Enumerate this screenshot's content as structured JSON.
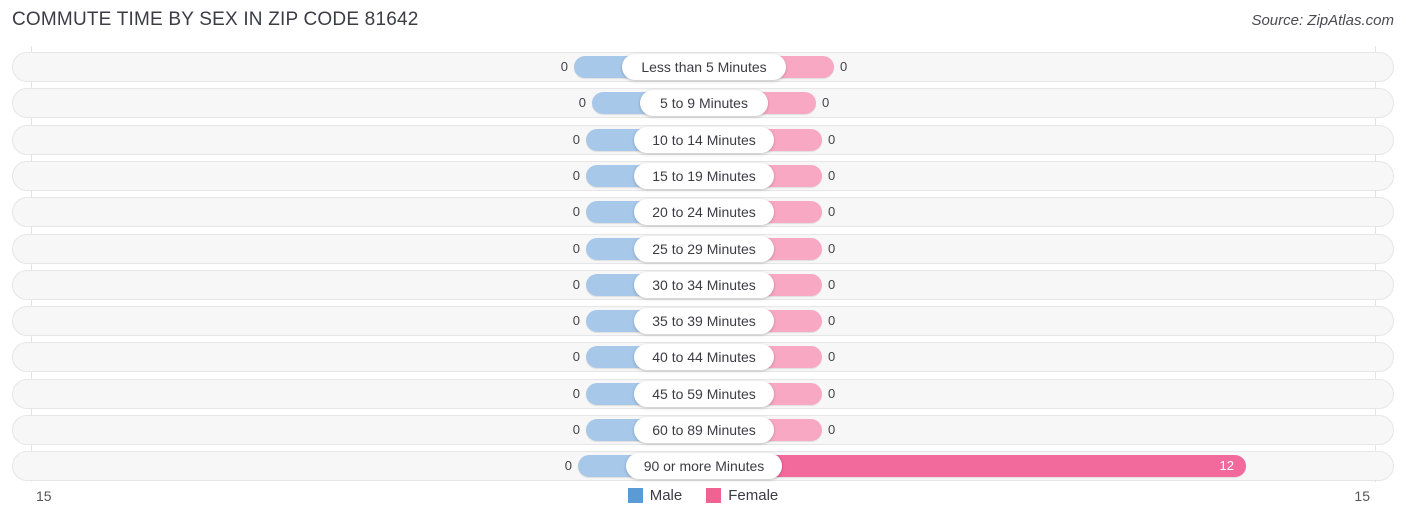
{
  "header": {
    "title": "COMMUTE TIME BY SEX IN ZIP CODE 81642",
    "source": "Source: ZipAtlas.com"
  },
  "legend": {
    "male": {
      "label": "Male",
      "color": "#5b9bd5"
    },
    "female": {
      "label": "Female",
      "color": "#f06292"
    }
  },
  "axis": {
    "left_label": "15",
    "right_label": "15"
  },
  "colors": {
    "male_bar": "#a8c8ea",
    "female_bar": "#f9a8c4",
    "female_bar_strong": "#f2699c",
    "row_background": "#f7f7f7",
    "row_border": "#e6e6e8",
    "gridline": "#e3e3e6"
  },
  "chart_data": {
    "type": "bar",
    "title": "COMMUTE TIME BY SEX IN ZIP CODE 81642",
    "subtitle": "Source: ZipAtlas.com",
    "orientation": "horizontal",
    "style": "diverging-bidirectional",
    "xlabel": "",
    "ylabel": "",
    "xlim": [
      15,
      15
    ],
    "grid": true,
    "legend_position": "bottom-center",
    "categories": [
      "Less than 5 Minutes",
      "5 to 9 Minutes",
      "10 to 14 Minutes",
      "15 to 19 Minutes",
      "20 to 24 Minutes",
      "25 to 29 Minutes",
      "30 to 34 Minutes",
      "35 to 39 Minutes",
      "40 to 44 Minutes",
      "45 to 59 Minutes",
      "60 to 89 Minutes",
      "90 or more Minutes"
    ],
    "series": [
      {
        "name": "Male",
        "direction": "left",
        "max": 15,
        "values": [
          0,
          0,
          0,
          0,
          0,
          0,
          0,
          0,
          0,
          0,
          0,
          0
        ],
        "value_labels": [
          "0",
          "0",
          "0",
          "0",
          "0",
          "0",
          "0",
          "0",
          "0",
          "0",
          "0",
          "0"
        ]
      },
      {
        "name": "Female",
        "direction": "right",
        "max": 15,
        "values": [
          0,
          0,
          0,
          0,
          0,
          0,
          0,
          0,
          0,
          0,
          0,
          12
        ],
        "value_labels": [
          "0",
          "0",
          "0",
          "0",
          "0",
          "0",
          "0",
          "0",
          "0",
          "0",
          "0",
          "12"
        ]
      }
    ],
    "rows": [
      {
        "label": "Less than 5 Minutes",
        "male": 0,
        "female": 0,
        "male_label": "0",
        "female_label": "0",
        "label_width": 164
      },
      {
        "label": "5 to 9 Minutes",
        "male": 0,
        "female": 0,
        "male_label": "0",
        "female_label": "0",
        "label_width": 128
      },
      {
        "label": "10 to 14 Minutes",
        "male": 0,
        "female": 0,
        "male_label": "0",
        "female_label": "0",
        "label_width": 140
      },
      {
        "label": "15 to 19 Minutes",
        "male": 0,
        "female": 0,
        "male_label": "0",
        "female_label": "0",
        "label_width": 140
      },
      {
        "label": "20 to 24 Minutes",
        "male": 0,
        "female": 0,
        "male_label": "0",
        "female_label": "0",
        "label_width": 140
      },
      {
        "label": "25 to 29 Minutes",
        "male": 0,
        "female": 0,
        "male_label": "0",
        "female_label": "0",
        "label_width": 140
      },
      {
        "label": "30 to 34 Minutes",
        "male": 0,
        "female": 0,
        "male_label": "0",
        "female_label": "0",
        "label_width": 140
      },
      {
        "label": "35 to 39 Minutes",
        "male": 0,
        "female": 0,
        "male_label": "0",
        "female_label": "0",
        "label_width": 140
      },
      {
        "label": "40 to 44 Minutes",
        "male": 0,
        "female": 0,
        "male_label": "0",
        "female_label": "0",
        "label_width": 140
      },
      {
        "label": "45 to 59 Minutes",
        "male": 0,
        "female": 0,
        "male_label": "0",
        "female_label": "0",
        "label_width": 140
      },
      {
        "label": "60 to 89 Minutes",
        "male": 0,
        "female": 0,
        "male_label": "0",
        "female_label": "0",
        "label_width": 140
      },
      {
        "label": "90 or more Minutes",
        "male": 0,
        "female": 12,
        "male_label": "0",
        "female_label": "12",
        "label_width": 156
      }
    ]
  }
}
